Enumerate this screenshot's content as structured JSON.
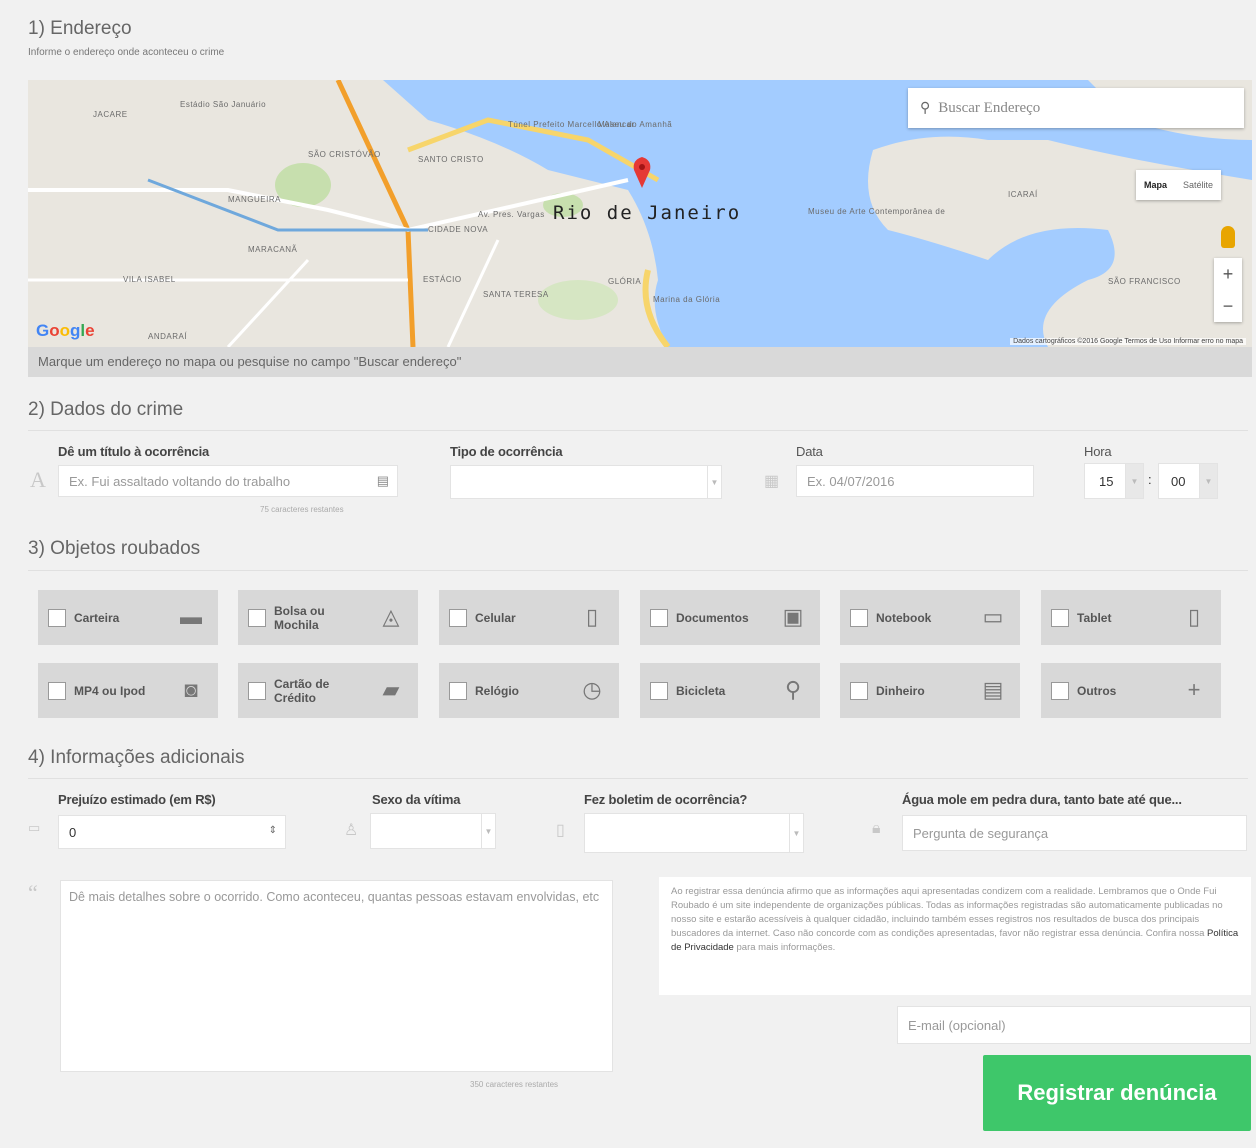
{
  "section1": {
    "title": "1) Endereço",
    "subtitle": "Informe o endereço onde aconteceu o crime",
    "map": {
      "search_placeholder": "Buscar Endereço",
      "view_map": "Mapa",
      "view_satellite": "Satélite",
      "zoom_in": "+",
      "zoom_out": "−",
      "footer": "Dados cartográficos ©2016 Google   Termos de Uso   Informar erro no mapa",
      "city_label": "Rio de Janeiro",
      "labels": [
        "JACARE",
        "Estádio São Januário",
        "SÃO CRISTÓVÃO",
        "SANTO CRISTO",
        "Túnel Prefeito Marcello Alencar",
        "Museu do Amanhã",
        "MANGUEIRA",
        "CIDADE NOVA",
        "MARACANÃ",
        "VILA ISABEL",
        "ESTÁCIO",
        "SANTA TERESA",
        "GLÓRIA",
        "Marina da Glória",
        "ANDARAÍ",
        "Museu de Arte Contemporânea de",
        "ICARAÍ",
        "SÃO FRANCISCO",
        "Av. Pres. Vargas"
      ],
      "google_logo": "Google"
    },
    "hint": "Marque um endereço no mapa ou pesquise no campo \"Buscar endereço\""
  },
  "section2": {
    "title": "2) Dados do crime",
    "title_label": "Dê um título à ocorrência",
    "title_placeholder": "Ex. Fui assaltado voltando do trabalho",
    "title_counter": "75 caracteres restantes",
    "type_label": "Tipo de ocorrência",
    "date_label": "Data",
    "date_placeholder": "Ex. 04/07/2016",
    "hour_label": "Hora",
    "hour_value": "15",
    "minute_value": "00",
    "colon": ":"
  },
  "section3": {
    "title": "3) Objetos roubados",
    "objects": [
      {
        "label": "Carteira",
        "icon": "wallet-icon",
        "glyph": "▬"
      },
      {
        "label": "Bolsa ou Mochila",
        "icon": "backpack-icon",
        "glyph": "◬"
      },
      {
        "label": "Celular",
        "icon": "phone-icon",
        "glyph": "▯"
      },
      {
        "label": "Documentos",
        "icon": "id-card-icon",
        "glyph": "▣"
      },
      {
        "label": "Notebook",
        "icon": "laptop-icon",
        "glyph": "▭"
      },
      {
        "label": "Tablet",
        "icon": "tablet-icon",
        "glyph": "▯"
      },
      {
        "label": "MP4 ou Ipod",
        "icon": "mp3-player-icon",
        "glyph": "◙"
      },
      {
        "label": "Cartão de Crédito",
        "icon": "credit-card-icon",
        "glyph": "▰"
      },
      {
        "label": "Relógio",
        "icon": "watch-icon",
        "glyph": "◷"
      },
      {
        "label": "Bicicleta",
        "icon": "bicycle-icon",
        "glyph": "⚲"
      },
      {
        "label": "Dinheiro",
        "icon": "money-icon",
        "glyph": "▤"
      },
      {
        "label": "Outros",
        "icon": "plus-icon",
        "glyph": "+"
      }
    ]
  },
  "section4": {
    "title": "4) Informações adicionais",
    "loss_label": "Prejuízo estimado (em R$)",
    "loss_value": "0",
    "gender_label": "Sexo da vítima",
    "report_label": "Fez boletim de ocorrência?",
    "security_label": "Água mole em pedra dura, tanto bate até que...",
    "security_placeholder": "Pergunta de segurança",
    "details_placeholder": "Dê mais detalhes sobre o ocorrido. Como aconteceu, quantas pessoas estavam envolvidas, etc",
    "details_counter": "350 caracteres restantes",
    "disclaimer_pre": "Ao registrar essa denúncia afirmo que as informações aqui apresentadas condizem com a realidade. Lembramos que o Onde Fui Roubado é um site independente de organizações públicas. Todas as informações registradas são automaticamente publicadas no nosso site e estarão acessíveis à qualquer cidadão, incluindo também esses registros nos resultados de busca dos principais buscadores da internet. Caso não concorde com as condições apresentadas, favor não registrar essa denúncia. Confira nossa ",
    "disclaimer_link": "Política de Privacidade",
    "disclaimer_post": " para mais informações.",
    "email_placeholder": "E-mail (opcional)",
    "submit_label": "Registrar denúncia"
  },
  "colors": {
    "accent": "#3ec76a",
    "map_water": "#a3ccff",
    "map_land": "#e9e6df",
    "pin": "#e53935"
  }
}
